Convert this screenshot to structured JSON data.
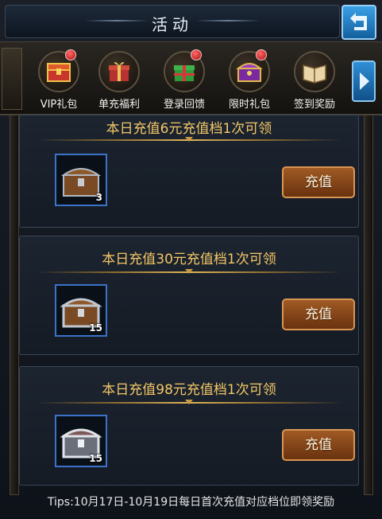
{
  "header": {
    "title": "活动"
  },
  "tabs": [
    {
      "label": "VIP礼包",
      "icon": "vip-chest-icon",
      "badge": true,
      "active": false
    },
    {
      "label": "单充福利",
      "icon": "gift-box-icon",
      "badge": false,
      "active": true
    },
    {
      "label": "登录回馈",
      "icon": "present-icon",
      "badge": true,
      "active": false
    },
    {
      "label": "限时礼包",
      "icon": "purple-chest-icon",
      "badge": true,
      "active": false
    },
    {
      "label": "签到奖励",
      "icon": "book-icon",
      "badge": false,
      "active": false
    }
  ],
  "rewards": [
    {
      "title": "本日充值6元充值档1次可领",
      "item_icon": "wooden-chest-icon",
      "quantity": "3",
      "button": "充值"
    },
    {
      "title": "本日充值30元充值档1次可领",
      "item_icon": "iron-bound-chest-icon",
      "quantity": "15",
      "button": "充值"
    },
    {
      "title": "本日充值98元充值档1次可领",
      "item_icon": "silver-chest-icon",
      "quantity": "15",
      "button": "充值"
    }
  ],
  "tips": "Tips:10月17日-10月19日每日首次充值对应档位即领奖励",
  "colors": {
    "accent_blue": "#3aa6f0",
    "gold_text": "#f3c766",
    "button_brown": "#8a4519"
  }
}
